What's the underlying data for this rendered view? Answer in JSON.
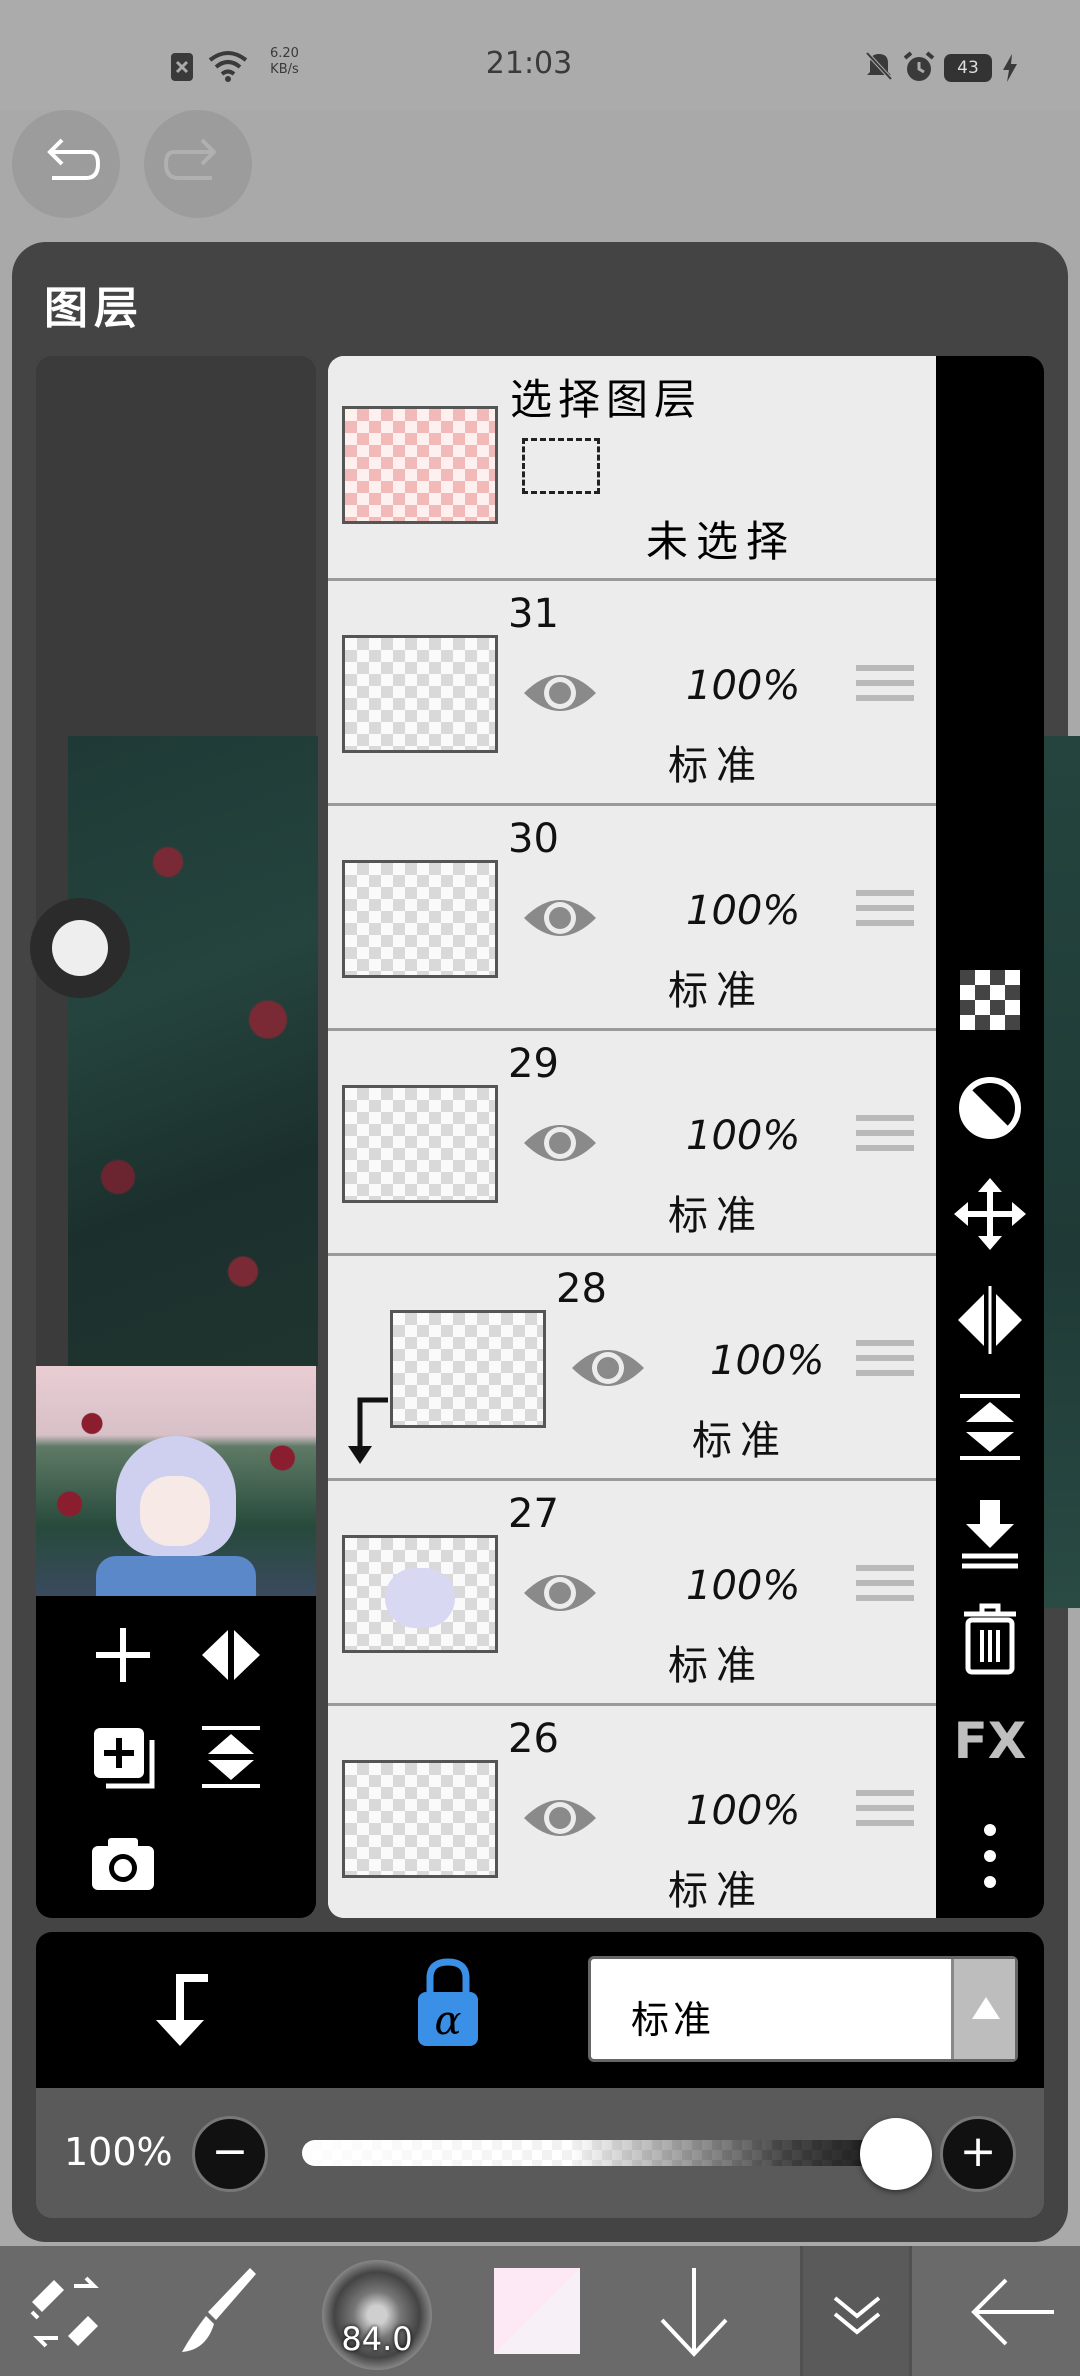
{
  "status_bar": {
    "time": "21:03",
    "net_speed_value": "6.20",
    "net_speed_unit": "KB/s",
    "battery": "43"
  },
  "panel": {
    "title": "图层"
  },
  "selection_layer": {
    "title": "选择图层",
    "status": "未选择"
  },
  "layers": [
    {
      "number": "31",
      "opacity": "100%",
      "blend": "标准"
    },
    {
      "number": "30",
      "opacity": "100%",
      "blend": "标准"
    },
    {
      "number": "29",
      "opacity": "100%",
      "blend": "标准"
    },
    {
      "number": "28",
      "opacity": "100%",
      "blend": "标准"
    },
    {
      "number": "27",
      "opacity": "100%",
      "blend": "标准"
    },
    {
      "number": "26",
      "opacity": "100%",
      "blend": "标准"
    }
  ],
  "right_tools": {
    "fx_label": "FX"
  },
  "blend_mode": {
    "selected": "标准"
  },
  "opacity": {
    "label": "100%",
    "value_percent": 100
  },
  "toolbar": {
    "brush_size": "84.0"
  },
  "colors": {
    "accent_blue": "#3a8fe6",
    "panel_bg": "#444444"
  }
}
